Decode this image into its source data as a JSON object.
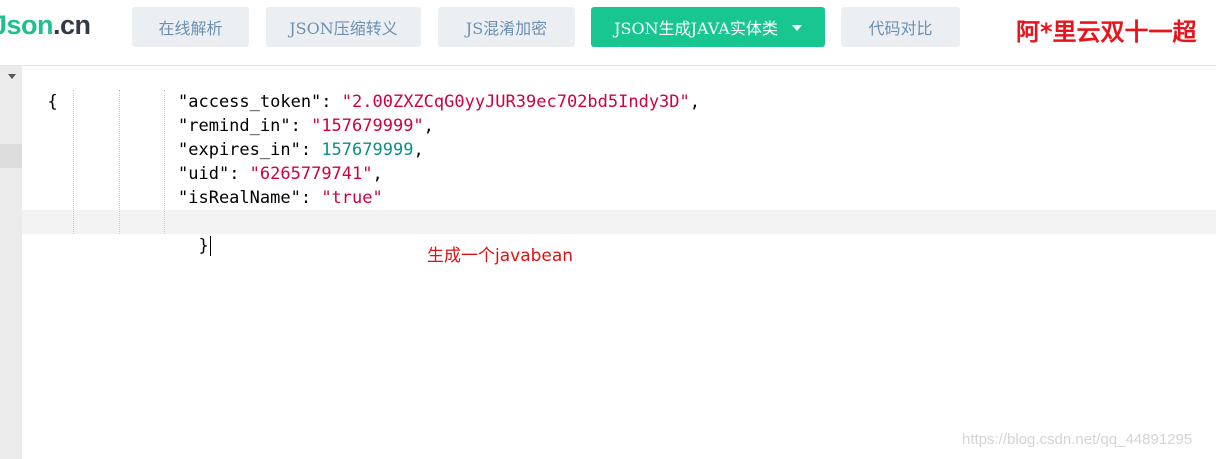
{
  "header": {
    "logo_part1": "Json",
    "logo_part2": ".cn",
    "nav": [
      {
        "label": "在线解析"
      },
      {
        "label": "JSON压缩转义"
      },
      {
        "label": "JS混淆加密"
      },
      {
        "label": "JSON生成JAVA实体类"
      },
      {
        "label": "代码对比"
      }
    ],
    "promo": "阿*里云双十一超"
  },
  "editor": {
    "open_brace": "{",
    "close_brace": "}",
    "entries": [
      {
        "key": "\"access_token\"",
        "sep": ": ",
        "value": "\"2.00ZXZCqG0yyJUR39ec702bd5Indy3D\"",
        "trail": ",",
        "type": "str"
      },
      {
        "key": "\"remind_in\"",
        "sep": ": ",
        "value": "\"157679999\"",
        "trail": ",",
        "type": "str"
      },
      {
        "key": "\"expires_in\"",
        "sep": ": ",
        "value": "157679999",
        "trail": ",",
        "type": "num"
      },
      {
        "key": "\"uid\"",
        "sep": ": ",
        "value": "\"6265779741\"",
        "trail": ",",
        "type": "str"
      },
      {
        "key": "\"isRealName\"",
        "sep": ": ",
        "value": "\"true\"",
        "trail": "",
        "type": "str"
      }
    ]
  },
  "annotation": "生成一个javabean",
  "watermark": "https://blog.csdn.net/qq_44891295",
  "colors": {
    "accent": "#18c690",
    "promo": "#e8141b",
    "string": "#d1003f",
    "number": "#0b8f88",
    "annotation": "#e01010"
  },
  "icons": {
    "fold": "triangle-down-icon",
    "dropdown": "caret-down-icon"
  }
}
